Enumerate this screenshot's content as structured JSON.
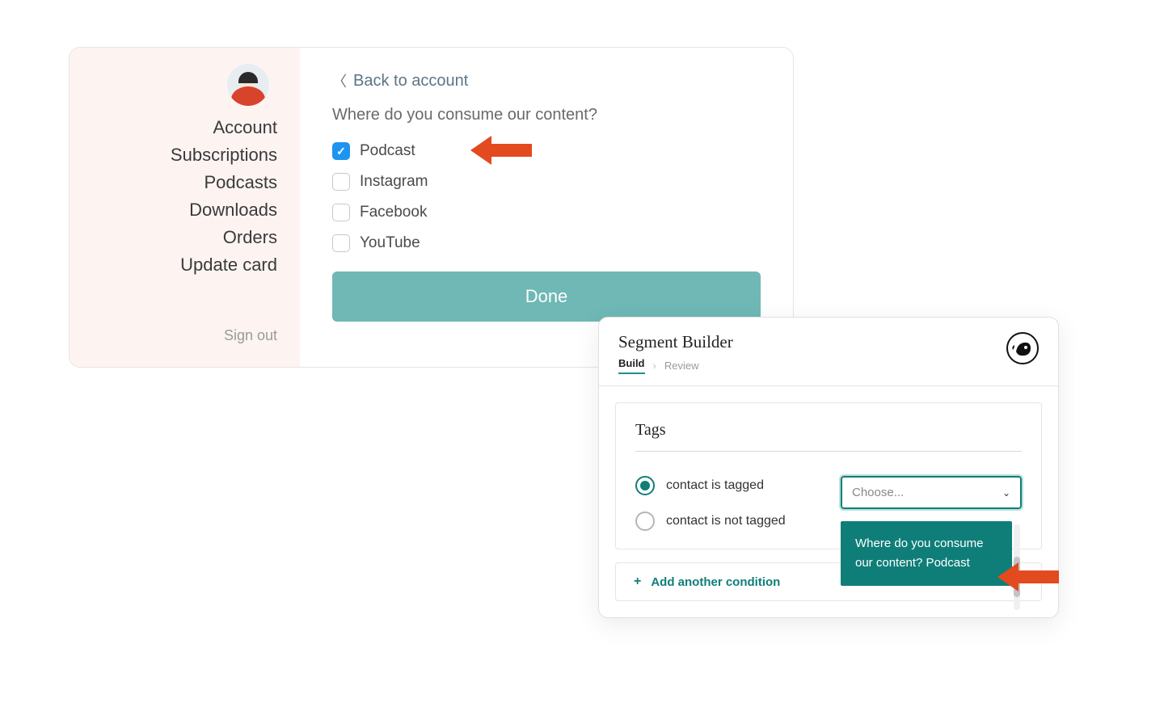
{
  "sidebar": {
    "items": [
      "Account",
      "Subscriptions",
      "Podcasts",
      "Downloads",
      "Orders",
      "Update card"
    ],
    "signout": "Sign out"
  },
  "main": {
    "back": "Back to account",
    "question": "Where do you consume our content?",
    "options": [
      {
        "label": "Podcast",
        "checked": true
      },
      {
        "label": "Instagram",
        "checked": false
      },
      {
        "label": "Facebook",
        "checked": false
      },
      {
        "label": "YouTube",
        "checked": false
      }
    ],
    "done": "Done"
  },
  "segment": {
    "title": "Segment Builder",
    "tab_active": "Build",
    "tab_inactive": "Review",
    "section": "Tags",
    "radios": [
      {
        "label": "contact is tagged",
        "selected": true
      },
      {
        "label": "contact is not tagged",
        "selected": false
      }
    ],
    "select_placeholder": "Choose...",
    "dropdown_option": "Where do you consume our content? Podcast",
    "add_condition": "Add another condition"
  }
}
